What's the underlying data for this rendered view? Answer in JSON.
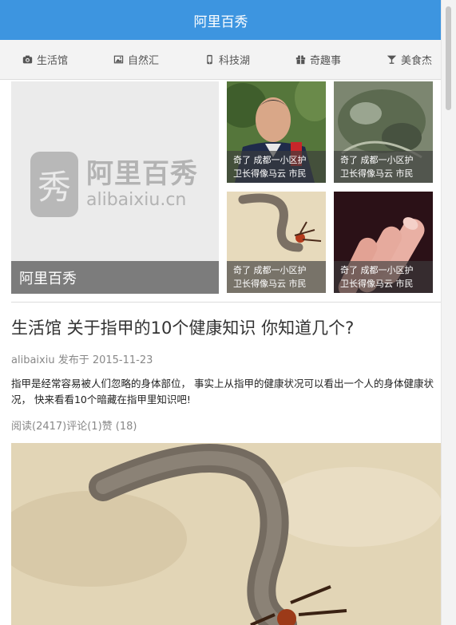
{
  "header": {
    "title": "阿里百秀"
  },
  "categories": [
    {
      "label": "生活馆",
      "icon": "camera-icon"
    },
    {
      "label": "自然汇",
      "icon": "image-icon"
    },
    {
      "label": "科技湖",
      "icon": "mobile-icon"
    },
    {
      "label": "奇趣事",
      "icon": "gift-icon"
    },
    {
      "label": "美食杰",
      "icon": "cocktail-icon"
    }
  ],
  "hero": {
    "main": {
      "logo_cn": "阿里百秀",
      "logo_en": "alibaixiu.cn",
      "logo_mark": "秀",
      "caption": "阿里百秀"
    },
    "thumbs": [
      {
        "caption_line1": "奇了 成都一小区护",
        "caption_line2": "卫长得像马云 市民"
      },
      {
        "caption_line1": "奇了 成都一小区护",
        "caption_line2": "卫长得像马云 市民"
      },
      {
        "caption_line1": "奇了 成都一小区护",
        "caption_line2": "卫长得像马云 市民"
      },
      {
        "caption_line1": "奇了 成都一小区护",
        "caption_line2": "卫长得像马云 市民"
      }
    ]
  },
  "article": {
    "title": "生活馆 关于指甲的10个健康知识 你知道几个?",
    "author": "alibaixiu",
    "published": "发布于 2015-11-23",
    "summary": "指甲是经常容易被人们忽略的身体部位， 事实上从指甲的健康状况可以看出一个人的身体健康状况， 快来看看10个暗藏在指甲里知识吧!",
    "reads": "阅读(2417)",
    "comments": "评论(1)",
    "likes": "赞 (18)"
  },
  "colors": {
    "header_bg": "#3d95e0",
    "catbar_bg": "#f3f3f3"
  }
}
